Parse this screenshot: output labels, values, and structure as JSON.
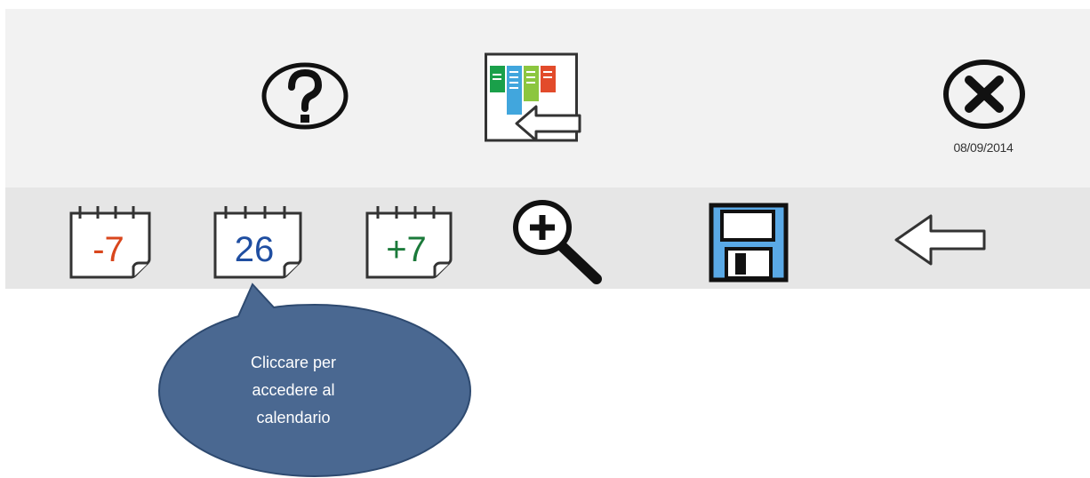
{
  "header": {
    "help_icon": "question-circle-icon",
    "planner_icon": "calendar-columns-back-icon",
    "close_icon": "close-circle-icon",
    "date": "08/09/2014"
  },
  "toolbar": {
    "prev_week_label": "-7",
    "current_day_label": "26",
    "next_week_label": "+7",
    "zoom_icon": "zoom-in-icon",
    "save_icon": "floppy-disk-icon",
    "back_icon": "arrow-left-icon"
  },
  "colors": {
    "minus_red": "#d9461c",
    "day_blue": "#1f4ea1",
    "plus_green": "#1b7a3a",
    "save_blue": "#5aa9e6",
    "callout_fill": "#4a6891",
    "callout_border": "#2e4a70",
    "planner_green": "#1aa04a",
    "planner_blue": "#41a6dd",
    "planner_lime": "#8cc63f",
    "planner_red": "#e24b2b"
  },
  "callout": {
    "text": "Cliccare per\naccedere al\ncalendario"
  }
}
